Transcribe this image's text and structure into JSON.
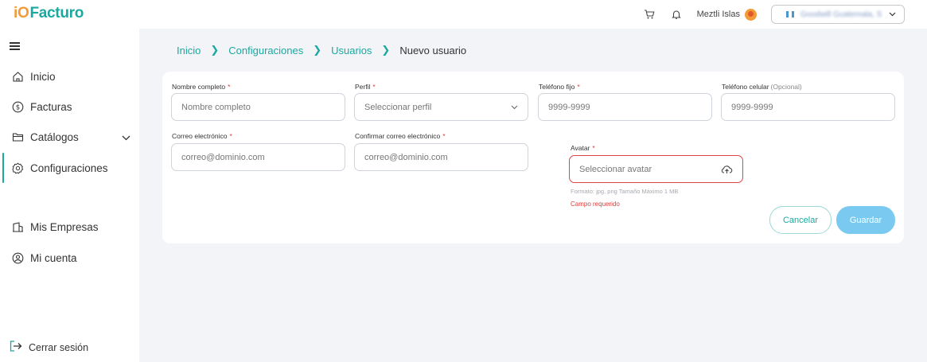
{
  "brand": {
    "prefix": "iO",
    "name": "Facturo",
    "color": "#1aa8a0",
    "accent": "#f29b38"
  },
  "header": {
    "cart_icon": "cart-icon",
    "bell_icon": "bell-icon",
    "user_name": "Meztli Islas",
    "company_name": "Goodwill Guatemala, S.A."
  },
  "sidebar": {
    "items": [
      {
        "label": "Inicio",
        "icon": "home-icon"
      },
      {
        "label": "Facturas",
        "icon": "dollar-icon"
      },
      {
        "label": "Catálogos",
        "icon": "folder-icon"
      },
      {
        "label": "Configuraciones",
        "icon": "gear-icon",
        "active": true
      },
      {
        "label": "Mis Empresas",
        "icon": "building-icon"
      },
      {
        "label": "Mi cuenta",
        "icon": "user-circle-icon"
      }
    ],
    "logout": "Cerrar sesión"
  },
  "breadcrumb": {
    "items": [
      "Inicio",
      "Configuraciones",
      "Usuarios"
    ],
    "current": "Nuevo usuario"
  },
  "form": {
    "nombre": {
      "label": "Nombre completo",
      "placeholder": "Nombre completo"
    },
    "perfil": {
      "label": "Perfil",
      "placeholder": "Seleccionar perfil"
    },
    "telefono_fijo": {
      "label": "Teléfono fijo",
      "placeholder": "9999-9999"
    },
    "telefono_celular": {
      "label": "Teléfono celular",
      "optional": "(Opcional)",
      "placeholder": "9999-9999"
    },
    "correo": {
      "label": "Correo electrónico",
      "placeholder": "correo@dominio.com"
    },
    "confirmar_correo": {
      "label": "Confirmar correo electrónico",
      "placeholder": "correo@dominio.com"
    },
    "avatar": {
      "label": "Avatar",
      "placeholder": "Seleccionar avatar",
      "hint": "Formato: jpg, png  Tamaño Máximo 1 MB",
      "error": "Campo requerido"
    },
    "required_mark": "*"
  },
  "buttons": {
    "cancel": "Cancelar",
    "save": "Guardar"
  }
}
